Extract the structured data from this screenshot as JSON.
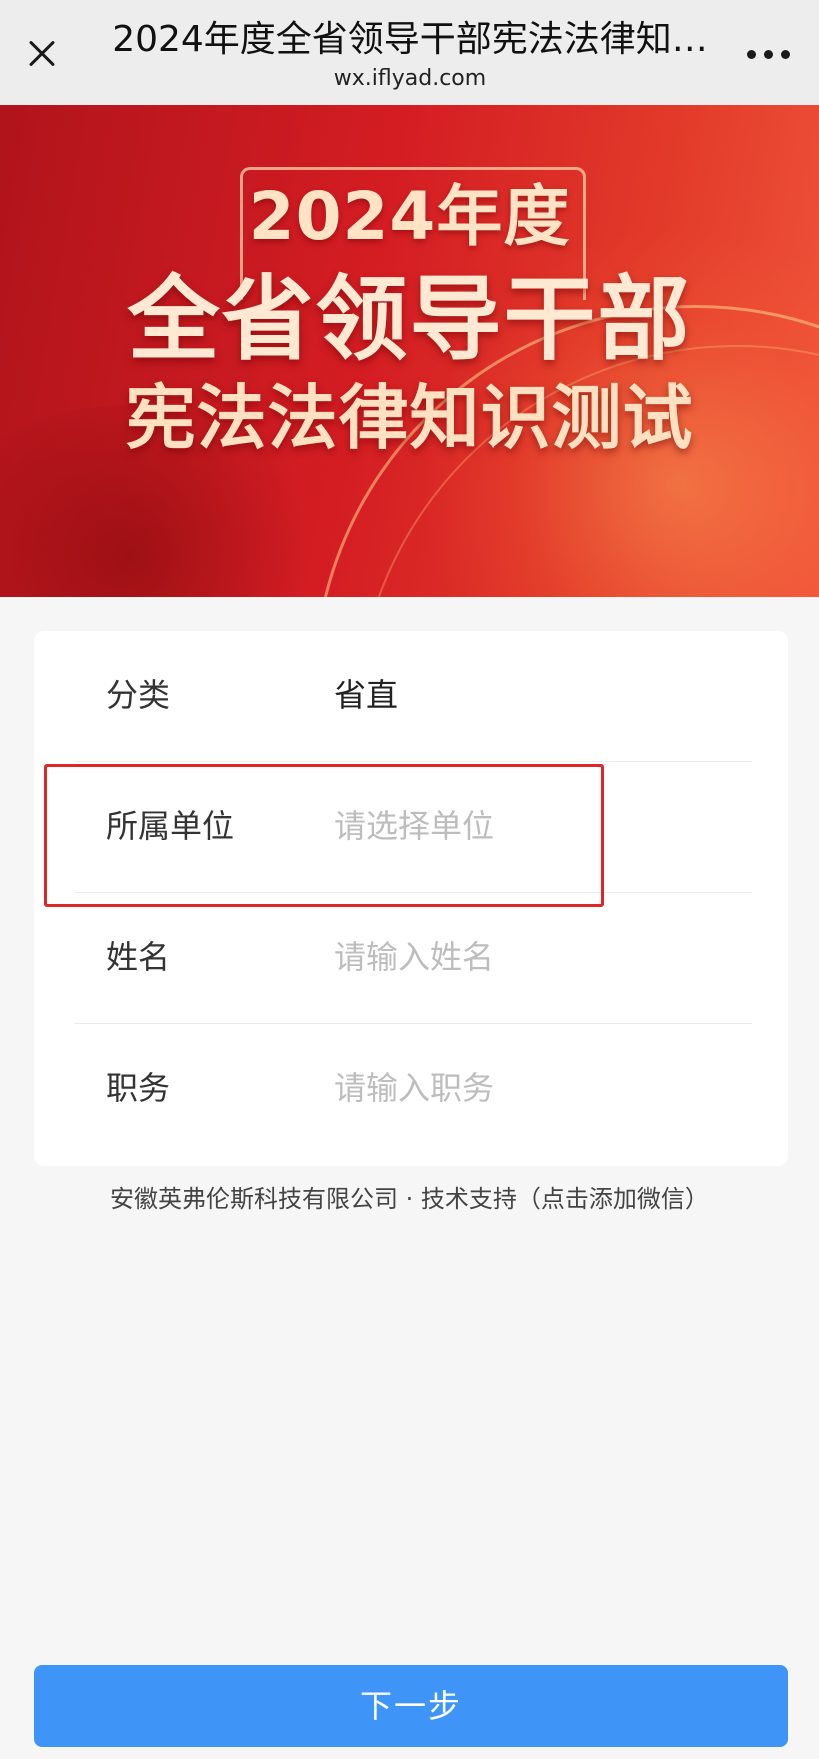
{
  "nav": {
    "title": "2024年度全省领导干部宪法法律知…",
    "url": "wx.iflyad.com"
  },
  "banner": {
    "year": "2024年度",
    "line1": "全省领导干部",
    "line2": "宪法法律知识测试"
  },
  "form": {
    "category": {
      "label": "分类",
      "value": "省直"
    },
    "unit": {
      "label": "所属单位",
      "placeholder": "请选择单位"
    },
    "name": {
      "label": "姓名",
      "placeholder": "请输入姓名"
    },
    "position": {
      "label": "职务",
      "placeholder": "请输入职务"
    }
  },
  "footer": {
    "credit": "安徽英弗伦斯科技有限公司 · 技术支持（点击添加微信）"
  },
  "actions": {
    "next_label": "下一步"
  },
  "colors": {
    "primary_button": "#3e95f7",
    "highlight_border": "#e02626",
    "banner_red": "#d41d23"
  },
  "icons": {
    "close": "close-icon",
    "more": "more-icon"
  }
}
